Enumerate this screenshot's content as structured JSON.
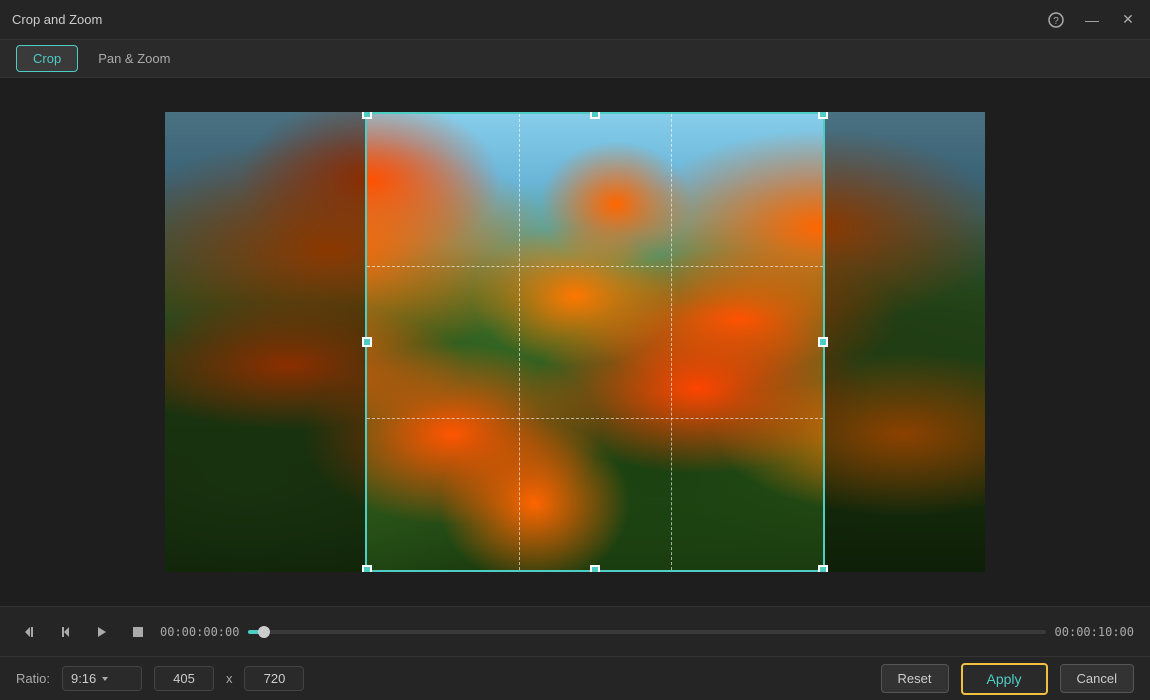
{
  "titleBar": {
    "title": "Crop and Zoom",
    "helpBtn": "?",
    "minimizeBtn": "—",
    "closeBtn": "✕"
  },
  "tabs": [
    {
      "id": "crop",
      "label": "Crop",
      "active": true
    },
    {
      "id": "pan-zoom",
      "label": "Pan & Zoom",
      "active": false
    }
  ],
  "controls": {
    "timeStart": "00:00:00:00",
    "timeEnd": "00:00:10:00"
  },
  "settings": {
    "ratioLabel": "Ratio:",
    "ratioValue": "9:16",
    "width": "405",
    "height": "720",
    "resetLabel": "Reset",
    "applyLabel": "Apply",
    "cancelLabel": "Cancel"
  }
}
